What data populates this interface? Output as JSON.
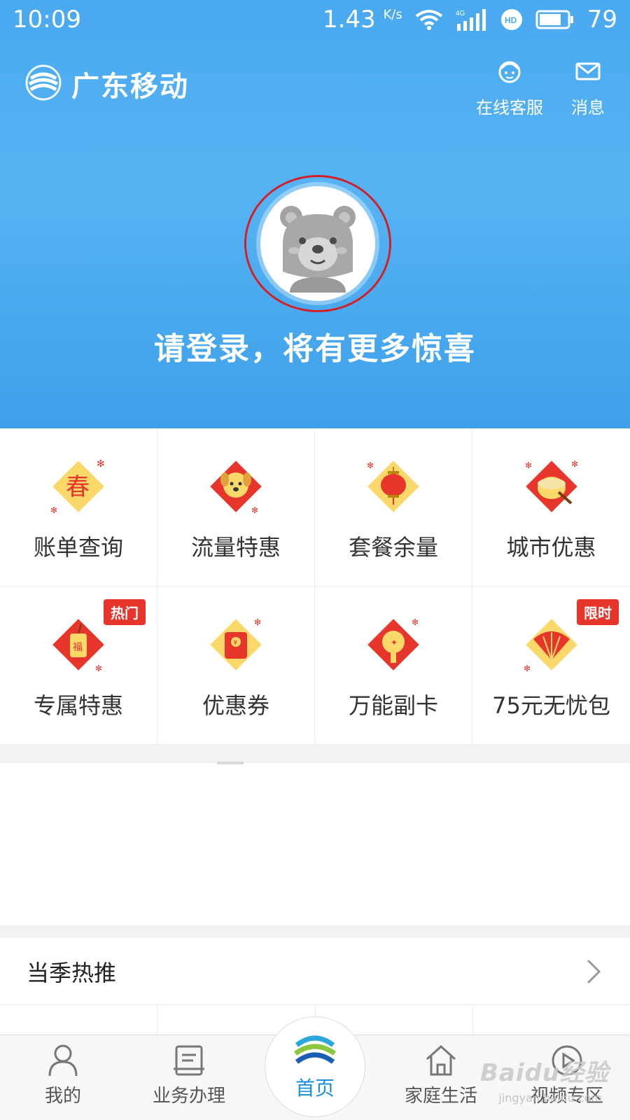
{
  "status_bar": {
    "time": "10:09",
    "speed": "1.43",
    "speed_unit": "K/s",
    "network": "4G",
    "battery": "79"
  },
  "header": {
    "brand": "广东移动",
    "actions": [
      {
        "label": "在线客服",
        "icon": "service-icon"
      },
      {
        "label": "消息",
        "icon": "message-icon"
      }
    ]
  },
  "hero": {
    "login_tip": "请登录，将有更多惊喜"
  },
  "services": [
    {
      "label": "账单查询",
      "icon": "spring-couplet-icon"
    },
    {
      "label": "流量特惠",
      "icon": "dog-icon"
    },
    {
      "label": "套餐余量",
      "icon": "lantern-icon"
    },
    {
      "label": "城市优惠",
      "icon": "drum-icon"
    },
    {
      "label": "专属特惠",
      "icon": "firecracker-icon",
      "badge": "热门"
    },
    {
      "label": "优惠券",
      "icon": "red-envelope-icon"
    },
    {
      "label": "万能副卡",
      "icon": "card-icon"
    },
    {
      "label": "75元无忧包",
      "icon": "fan-icon",
      "badge": "限时"
    }
  ],
  "section": {
    "title": "当季热推"
  },
  "tabbar": {
    "tabs": [
      {
        "label": "我的",
        "icon": "person-icon"
      },
      {
        "label": "业务办理",
        "icon": "document-icon"
      },
      {
        "label": "首页",
        "icon": "china-mobile-logo-icon"
      },
      {
        "label": "家庭生活",
        "icon": "home-icon"
      },
      {
        "label": "视频专区",
        "icon": "play-icon"
      }
    ],
    "watermark": "Baidu经验",
    "watermark_sub": "jingyan.baidu.com"
  },
  "colors": {
    "hero_blue": "#4aa9ef",
    "badge_red": "#e7352b",
    "highlight_circle": "#d0202a",
    "home_blue": "#1a8fe0"
  }
}
